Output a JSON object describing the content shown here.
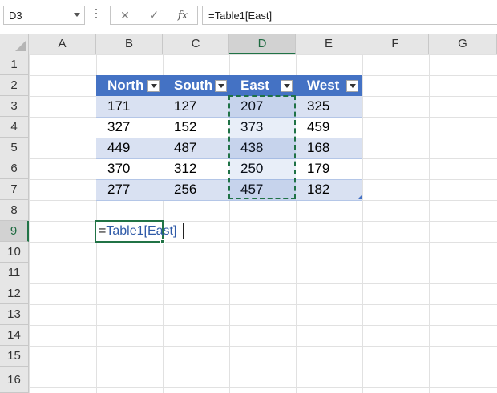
{
  "name_box": {
    "value": "D3"
  },
  "formula_bar": {
    "cancel_glyph": "✕",
    "enter_glyph": "✓",
    "fx_label": "fx",
    "formula": "=Table1[East]"
  },
  "columns": [
    "A",
    "B",
    "C",
    "D",
    "E",
    "F",
    "G"
  ],
  "rows": [
    "1",
    "2",
    "3",
    "4",
    "5",
    "6",
    "7",
    "8",
    "9",
    "10",
    "11",
    "12",
    "13",
    "14",
    "15",
    "16"
  ],
  "selected": {
    "column": "D",
    "row": "9"
  },
  "table": {
    "name": "Table1",
    "headers": [
      "North",
      "South",
      "East",
      "West"
    ],
    "rows": [
      [
        "171",
        "127",
        "207",
        "325"
      ],
      [
        "327",
        "152",
        "373",
        "459"
      ],
      [
        "449",
        "487",
        "438",
        "168"
      ],
      [
        "370",
        "312",
        "250",
        "179"
      ],
      [
        "277",
        "256",
        "457",
        "182"
      ]
    ]
  },
  "editing_cell": {
    "address": "B9",
    "prefix": "=",
    "reference": "Table1[East]"
  },
  "colors": {
    "header_blue": "#4472c4",
    "band_blue": "#d9e1f2",
    "excel_green": "#217346",
    "reference_blue": "#2f5aa8"
  }
}
